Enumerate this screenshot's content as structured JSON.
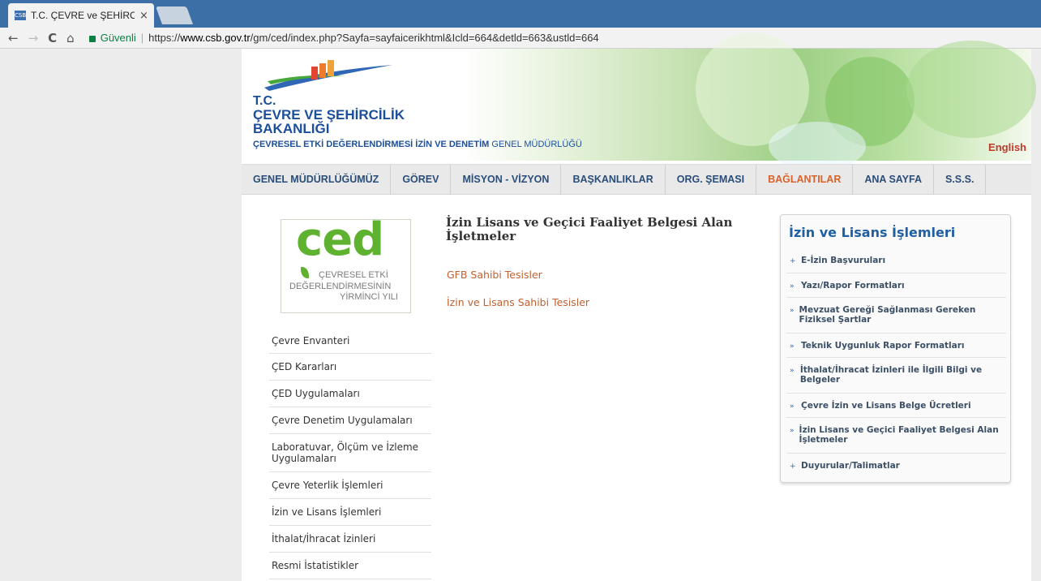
{
  "browser": {
    "tab_title": "T.C. ÇEVRE ve ŞEHİRCİLİ",
    "tab_favicon": "CSB",
    "close_glyph": "×",
    "back": "←",
    "forward": "→",
    "reload": "C",
    "home": "⌂",
    "secure_label": "Güvenli",
    "url_prefix": "https://",
    "url_host": "www.csb.gov.tr",
    "url_path": "/gm/ced/index.php?Sayfa=sayfaicerikhtml&Icld=664&detld=663&ustld=664"
  },
  "header": {
    "brand_line1": "T.C.",
    "brand_line2": "ÇEVRE VE ŞEHİRCİLİK",
    "brand_line3": "BAKANLIĞI",
    "subtitle_bold": "ÇEVRESEL ETKİ DEĞERLENDİRMESİ İZİN VE DENETİM",
    "subtitle_thin": "GENEL MÜDÜRLÜĞÜ",
    "english": "English",
    "colors": {
      "brand": "#1b4e9b",
      "accent": "#d9622b"
    }
  },
  "topnav": [
    "GENEL MÜDÜRLÜĞÜMÜZ",
    "GÖREV",
    "MİSYON - VİZYON",
    "BAŞKANLIKLAR",
    "ORG. ŞEMASI",
    "BAĞLANTILAR",
    "ANA SAYFA",
    "S.S.S."
  ],
  "ced_logo": {
    "mark": "ced",
    "line1": "ÇEVRESEL ETKİ",
    "line2": "DEĞERLENDİRMESİNİN",
    "line3": "YİRMİNCİ YILI"
  },
  "sidemenu": [
    "Çevre Envanteri",
    "ÇED Kararları",
    "ÇED Uygulamaları",
    "Çevre Denetim Uygulamaları",
    "Laboratuvar, Ölçüm ve İzleme Uygulamaları",
    "Çevre Yeterlik İşlemleri",
    "İzin ve Lisans İşlemleri",
    "İthalat/İhracat İzinleri",
    "Resmi İstatistikler"
  ],
  "content": {
    "title": "İzin Lisans ve Geçici Faaliyet Belgesi Alan İşletmeler",
    "links": [
      "GFB Sahibi Tesisler",
      "İzin ve Lisans Sahibi Tesisler"
    ]
  },
  "rpanel": {
    "title": "İzin ve Lisans İşlemleri",
    "items": [
      {
        "bullet": "+",
        "label": "E-İzin Başvuruları"
      },
      {
        "bullet": "»",
        "label": "Yazı/Rapor Formatları"
      },
      {
        "bullet": "»",
        "label": "Mevzuat Gereği Sağlanması Gereken Fiziksel Şartlar"
      },
      {
        "bullet": "»",
        "label": "Teknik Uygunluk Rapor Formatları"
      },
      {
        "bullet": "»",
        "label": "İthalat/İhracat İzinleri ile İlgili Bilgi ve Belgeler"
      },
      {
        "bullet": "»",
        "label": "Çevre İzin ve Lisans Belge Ücretleri"
      },
      {
        "bullet": "»",
        "label": "İzin Lisans ve Geçici Faaliyet Belgesi Alan İşletmeler"
      },
      {
        "bullet": "+",
        "label": "Duyurular/Talimatlar"
      }
    ]
  }
}
